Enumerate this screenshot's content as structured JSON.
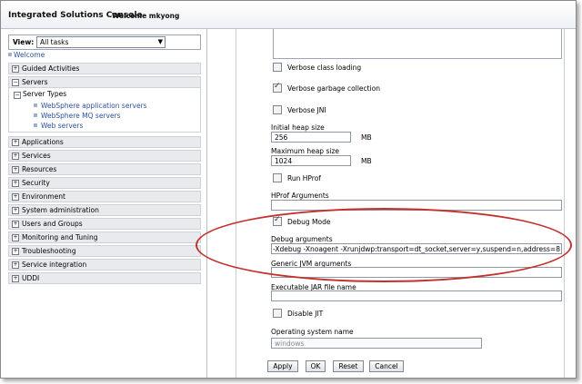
{
  "header": {
    "app_title": "Integrated Solutions Console",
    "welcome_text": "Welcome mkyong"
  },
  "nav": {
    "view_label": "View:",
    "view_value": "All tasks",
    "welcome_link": "Welcome",
    "sections": {
      "guided": "Guided Activities",
      "servers": "Servers",
      "server_types": "Server Types",
      "server_links": [
        "WebSphere application servers",
        "WebSphere MQ servers",
        "Web servers"
      ],
      "applications": "Applications",
      "services": "Services",
      "resources": "Resources",
      "security": "Security",
      "environment": "Environment",
      "system_admin": "System administration",
      "users_groups": "Users and Groups",
      "monitoring": "Monitoring and Tuning",
      "troubleshooting": "Troubleshooting",
      "service_integration": "Service integration",
      "uddi": "UDDI"
    }
  },
  "form": {
    "verbose_class_loading": "Verbose class loading",
    "verbose_gc": "Verbose garbage collection",
    "verbose_jni": "Verbose JNI",
    "initial_heap_label": "Initial heap size",
    "initial_heap_value": "256",
    "max_heap_label": "Maximum heap size",
    "max_heap_value": "1024",
    "unit_mb": "MB",
    "run_hprof": "Run HProf",
    "hprof_args_label": "HProf Arguments",
    "debug_mode": "Debug Mode",
    "debug_args_label": "Debug arguments",
    "debug_args_value": "-Xdebug -Xnoagent -Xrunjdwp:transport=dt_socket,server=y,suspend=n,address=8",
    "generic_jvm_label": "Generic JVM arguments",
    "exec_jar_label": "Executable JAR file name",
    "disable_jit": "Disable JIT",
    "os_name_label": "Operating system name",
    "os_name_value": "windows"
  },
  "buttons": {
    "apply": "Apply",
    "ok": "OK",
    "reset": "Reset",
    "cancel": "Cancel"
  },
  "colors": {
    "highlight_oval": "#c4312c",
    "link": "#2c4f9e"
  }
}
